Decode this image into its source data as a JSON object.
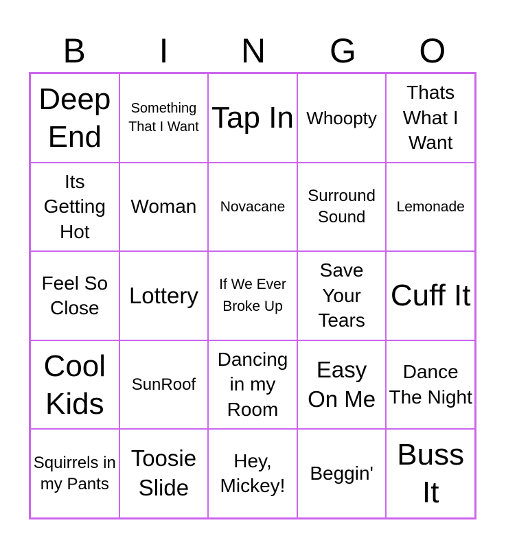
{
  "header": {
    "letters": [
      "B",
      "I",
      "N",
      "G",
      "O"
    ]
  },
  "accent_color": "#cc66ee",
  "cells": [
    [
      "Deep End",
      "Something That I Want",
      "Tap In",
      "Whoopty",
      "Thats What I Want"
    ],
    [
      "Its Getting Hot",
      "Woman",
      "Novacane",
      "Surround Sound",
      "Lemonade"
    ],
    [
      "Feel So Close",
      "Lottery",
      "If We Ever Broke Up",
      "Save Your Tears",
      "Cuff It"
    ],
    [
      "Cool Kids",
      "SunRoof",
      "Dancing in my Room",
      "Easy On Me",
      "Dance The Night"
    ],
    [
      "Squirrels in my Pants",
      "Toosie Slide",
      "Hey, Mickey!",
      "Beggin'",
      "Buss It"
    ]
  ]
}
